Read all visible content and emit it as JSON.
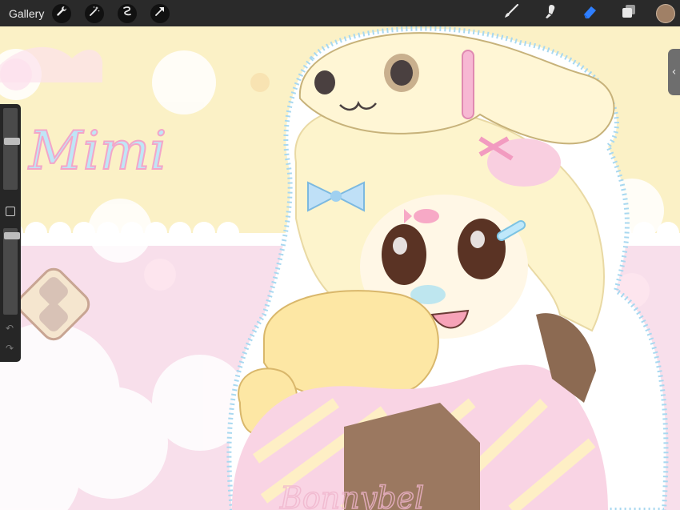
{
  "toolbar": {
    "gallery_label": "Gallery",
    "left_tools": [
      "wrench-icon",
      "magic-wand-icon",
      "selection-icon",
      "transform-arrow-icon"
    ],
    "right_tools": [
      "brush-icon",
      "smudge-icon",
      "eraser-icon",
      "layers-icon"
    ],
    "active_tool": "eraser-icon",
    "current_color": "#a08066"
  },
  "sidebar": {
    "brush_size_level": 0.6,
    "opacity_level": 0.95
  },
  "artwork": {
    "title_text": "Mimi",
    "signature_text": "Bonnybel"
  },
  "colors": {
    "accent_blue": "#2f7fff",
    "bg_yellow": "#fbf1c6",
    "bg_pink": "#f8dfeb",
    "outline_blue": "#a8d8f0"
  }
}
